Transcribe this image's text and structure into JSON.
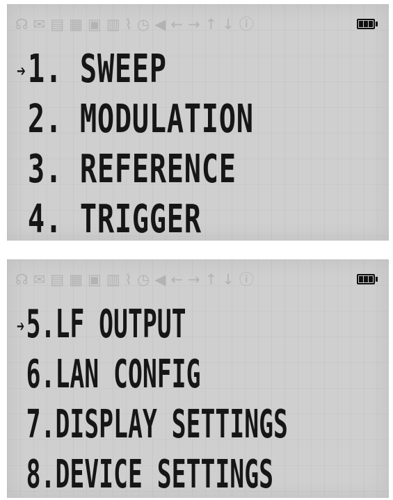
{
  "status_bar": {
    "icons": [
      {
        "name": "headset-icon",
        "glyph": "☊"
      },
      {
        "name": "mail-icon",
        "glyph": "✉"
      },
      {
        "name": "folder-icon",
        "glyph": "▤"
      },
      {
        "name": "clipboard-icon",
        "glyph": "▦"
      },
      {
        "name": "disk-icon",
        "glyph": "▣"
      },
      {
        "name": "usb-icon",
        "glyph": "▥"
      },
      {
        "name": "thermometer-icon",
        "glyph": "⌇"
      },
      {
        "name": "clock-icon",
        "glyph": "◷"
      },
      {
        "name": "speaker-icon",
        "glyph": "◀"
      },
      {
        "name": "arrow-left-icon",
        "glyph": "←"
      },
      {
        "name": "arrow-right-icon",
        "glyph": "→"
      },
      {
        "name": "arrow-up-icon",
        "glyph": "↑"
      },
      {
        "name": "arrow-down-icon",
        "glyph": "↓"
      },
      {
        "name": "info-icon",
        "glyph": "ⓘ"
      }
    ],
    "battery_level": 1.0
  },
  "cursor_glyph": "➔",
  "colors": {
    "lcd_background": "#cfcfcf",
    "pixel_on": "#161616",
    "pixel_off": "#b3b3b3"
  },
  "screens": [
    {
      "selected_index": 0,
      "items": [
        "1. SWEEP",
        "2. MODULATION",
        "3. REFERENCE",
        "4. TRIGGER"
      ]
    },
    {
      "selected_index": 0,
      "items": [
        "5.LF OUTPUT",
        "6.LAN CONFIG",
        "7.DISPLAY SETTINGS",
        "8.DEVICE SETTINGS"
      ]
    }
  ]
}
